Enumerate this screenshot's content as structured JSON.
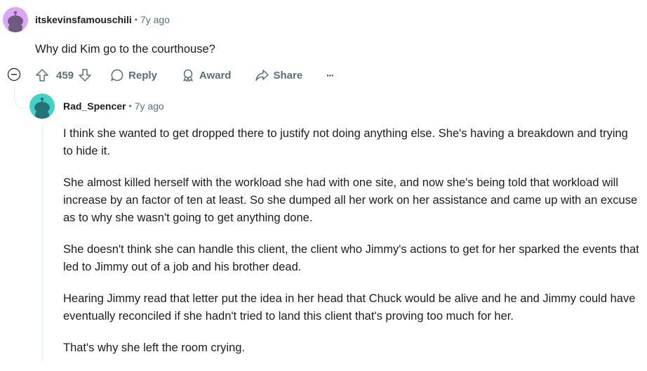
{
  "parent_comment": {
    "author": "itskevinsfamouschili",
    "separator": "•",
    "time": "7y ago",
    "text": "Why did Kim go to the courthouse?",
    "votes": "459",
    "actions": {
      "reply": "Reply",
      "award": "Award",
      "share": "Share",
      "more": "···"
    }
  },
  "reply_comment": {
    "author": "Rad_Spencer",
    "separator": "•",
    "time": "7y ago",
    "paragraphs": [
      "I think she wanted to get dropped there to justify not doing anything else. She's having a breakdown and trying to hide it.",
      "She almost killed herself with the workload she had with one site, and now she's being told that workload will increase by an factor of ten at least. So she dumped all her work on her assistance and came up with an excuse as to why she wasn't going to get anything done.",
      "She doesn't think she can handle this client, the client who Jimmy's actions to get for her sparked the events that led to Jimmy out of a job and his brother dead.",
      "Hearing Jimmy read that letter put the idea in her head that Chuck would be alive and he and Jimmy could have eventually reconciled if she hadn't tried to land this client that's proving too much for her.",
      "That's why she left the room crying."
    ]
  },
  "colors": {
    "parent_avatar_bg": "#d9a7f5",
    "reply_avatar_bg": "#46d1c6",
    "muted": "#576f76"
  }
}
